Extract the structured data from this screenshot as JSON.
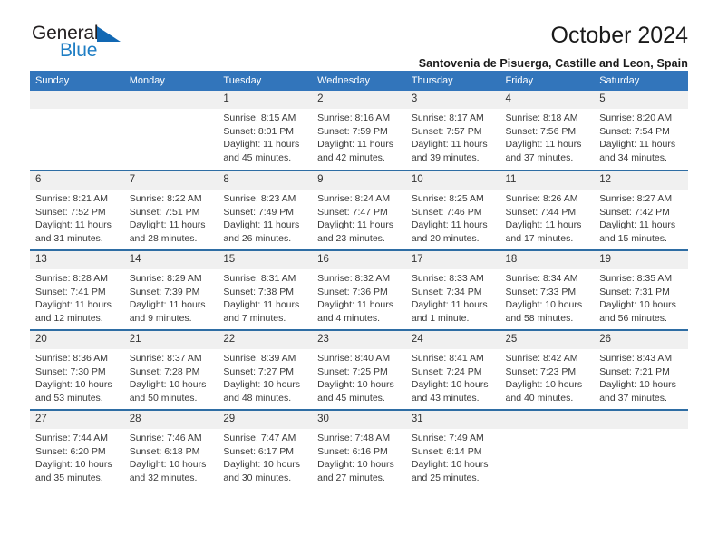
{
  "brand": {
    "name_part1": "General",
    "name_part2": "Blue",
    "triangle_color": "#1268b3",
    "blue_text_color": "#1f7ec4"
  },
  "header": {
    "title": "October 2024",
    "subtitle": "Santovenia de Pisuerga, Castille and Leon, Spain"
  },
  "theme": {
    "header_blue": "#3275bb",
    "row_divider_blue": "#2e6da4",
    "daynum_background": "#f0f0f0"
  },
  "calendar": {
    "weekday_headers": [
      "Sunday",
      "Monday",
      "Tuesday",
      "Wednesday",
      "Thursday",
      "Friday",
      "Saturday"
    ],
    "weeks": [
      [
        {
          "day": "",
          "empty": true
        },
        {
          "day": "",
          "empty": true
        },
        {
          "day": "1",
          "sunrise": "Sunrise: 8:15 AM",
          "sunset": "Sunset: 8:01 PM",
          "daylight": "Daylight: 11 hours and 45 minutes."
        },
        {
          "day": "2",
          "sunrise": "Sunrise: 8:16 AM",
          "sunset": "Sunset: 7:59 PM",
          "daylight": "Daylight: 11 hours and 42 minutes."
        },
        {
          "day": "3",
          "sunrise": "Sunrise: 8:17 AM",
          "sunset": "Sunset: 7:57 PM",
          "daylight": "Daylight: 11 hours and 39 minutes."
        },
        {
          "day": "4",
          "sunrise": "Sunrise: 8:18 AM",
          "sunset": "Sunset: 7:56 PM",
          "daylight": "Daylight: 11 hours and 37 minutes."
        },
        {
          "day": "5",
          "sunrise": "Sunrise: 8:20 AM",
          "sunset": "Sunset: 7:54 PM",
          "daylight": "Daylight: 11 hours and 34 minutes."
        }
      ],
      [
        {
          "day": "6",
          "sunrise": "Sunrise: 8:21 AM",
          "sunset": "Sunset: 7:52 PM",
          "daylight": "Daylight: 11 hours and 31 minutes."
        },
        {
          "day": "7",
          "sunrise": "Sunrise: 8:22 AM",
          "sunset": "Sunset: 7:51 PM",
          "daylight": "Daylight: 11 hours and 28 minutes."
        },
        {
          "day": "8",
          "sunrise": "Sunrise: 8:23 AM",
          "sunset": "Sunset: 7:49 PM",
          "daylight": "Daylight: 11 hours and 26 minutes."
        },
        {
          "day": "9",
          "sunrise": "Sunrise: 8:24 AM",
          "sunset": "Sunset: 7:47 PM",
          "daylight": "Daylight: 11 hours and 23 minutes."
        },
        {
          "day": "10",
          "sunrise": "Sunrise: 8:25 AM",
          "sunset": "Sunset: 7:46 PM",
          "daylight": "Daylight: 11 hours and 20 minutes."
        },
        {
          "day": "11",
          "sunrise": "Sunrise: 8:26 AM",
          "sunset": "Sunset: 7:44 PM",
          "daylight": "Daylight: 11 hours and 17 minutes."
        },
        {
          "day": "12",
          "sunrise": "Sunrise: 8:27 AM",
          "sunset": "Sunset: 7:42 PM",
          "daylight": "Daylight: 11 hours and 15 minutes."
        }
      ],
      [
        {
          "day": "13",
          "sunrise": "Sunrise: 8:28 AM",
          "sunset": "Sunset: 7:41 PM",
          "daylight": "Daylight: 11 hours and 12 minutes."
        },
        {
          "day": "14",
          "sunrise": "Sunrise: 8:29 AM",
          "sunset": "Sunset: 7:39 PM",
          "daylight": "Daylight: 11 hours and 9 minutes."
        },
        {
          "day": "15",
          "sunrise": "Sunrise: 8:31 AM",
          "sunset": "Sunset: 7:38 PM",
          "daylight": "Daylight: 11 hours and 7 minutes."
        },
        {
          "day": "16",
          "sunrise": "Sunrise: 8:32 AM",
          "sunset": "Sunset: 7:36 PM",
          "daylight": "Daylight: 11 hours and 4 minutes."
        },
        {
          "day": "17",
          "sunrise": "Sunrise: 8:33 AM",
          "sunset": "Sunset: 7:34 PM",
          "daylight": "Daylight: 11 hours and 1 minute."
        },
        {
          "day": "18",
          "sunrise": "Sunrise: 8:34 AM",
          "sunset": "Sunset: 7:33 PM",
          "daylight": "Daylight: 10 hours and 58 minutes."
        },
        {
          "day": "19",
          "sunrise": "Sunrise: 8:35 AM",
          "sunset": "Sunset: 7:31 PM",
          "daylight": "Daylight: 10 hours and 56 minutes."
        }
      ],
      [
        {
          "day": "20",
          "sunrise": "Sunrise: 8:36 AM",
          "sunset": "Sunset: 7:30 PM",
          "daylight": "Daylight: 10 hours and 53 minutes."
        },
        {
          "day": "21",
          "sunrise": "Sunrise: 8:37 AM",
          "sunset": "Sunset: 7:28 PM",
          "daylight": "Daylight: 10 hours and 50 minutes."
        },
        {
          "day": "22",
          "sunrise": "Sunrise: 8:39 AM",
          "sunset": "Sunset: 7:27 PM",
          "daylight": "Daylight: 10 hours and 48 minutes."
        },
        {
          "day": "23",
          "sunrise": "Sunrise: 8:40 AM",
          "sunset": "Sunset: 7:25 PM",
          "daylight": "Daylight: 10 hours and 45 minutes."
        },
        {
          "day": "24",
          "sunrise": "Sunrise: 8:41 AM",
          "sunset": "Sunset: 7:24 PM",
          "daylight": "Daylight: 10 hours and 43 minutes."
        },
        {
          "day": "25",
          "sunrise": "Sunrise: 8:42 AM",
          "sunset": "Sunset: 7:23 PM",
          "daylight": "Daylight: 10 hours and 40 minutes."
        },
        {
          "day": "26",
          "sunrise": "Sunrise: 8:43 AM",
          "sunset": "Sunset: 7:21 PM",
          "daylight": "Daylight: 10 hours and 37 minutes."
        }
      ],
      [
        {
          "day": "27",
          "sunrise": "Sunrise: 7:44 AM",
          "sunset": "Sunset: 6:20 PM",
          "daylight": "Daylight: 10 hours and 35 minutes."
        },
        {
          "day": "28",
          "sunrise": "Sunrise: 7:46 AM",
          "sunset": "Sunset: 6:18 PM",
          "daylight": "Daylight: 10 hours and 32 minutes."
        },
        {
          "day": "29",
          "sunrise": "Sunrise: 7:47 AM",
          "sunset": "Sunset: 6:17 PM",
          "daylight": "Daylight: 10 hours and 30 minutes."
        },
        {
          "day": "30",
          "sunrise": "Sunrise: 7:48 AM",
          "sunset": "Sunset: 6:16 PM",
          "daylight": "Daylight: 10 hours and 27 minutes."
        },
        {
          "day": "31",
          "sunrise": "Sunrise: 7:49 AM",
          "sunset": "Sunset: 6:14 PM",
          "daylight": "Daylight: 10 hours and 25 minutes."
        },
        {
          "day": "",
          "empty": true
        },
        {
          "day": "",
          "empty": true
        }
      ]
    ]
  }
}
